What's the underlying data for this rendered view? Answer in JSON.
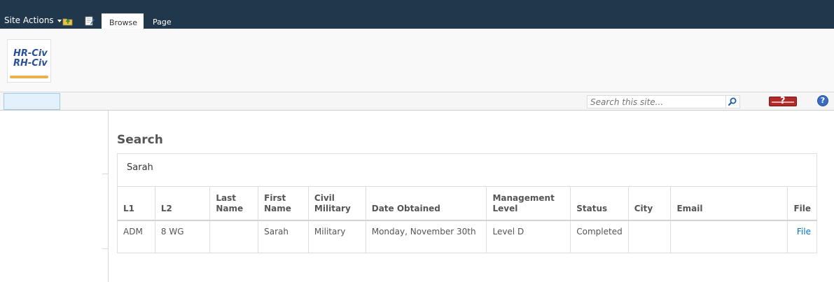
{
  "ribbon": {
    "site_actions": "Site Actions",
    "tabs": [
      {
        "label": "Browse",
        "selected": true
      },
      {
        "label": "Page",
        "selected": false
      }
    ],
    "icons": [
      "navigate-up-icon",
      "edit-page-icon"
    ]
  },
  "site": {
    "logo_line1": "HR-Civ",
    "logo_line2": "RH-Civ"
  },
  "topnav": {
    "search_placeholder": "Search this site...",
    "search_icon": "search-icon",
    "alert_icon": "alert-icon",
    "help_icon": "help-icon",
    "help_glyph": "?"
  },
  "main": {
    "title": "Search",
    "search_value": "Sarah",
    "table": {
      "columns": [
        "L1",
        "L2",
        "Last Name",
        "First Name",
        "Civil Military",
        "Date Obtained",
        "Management Level",
        "Status",
        "City",
        "Email",
        "File"
      ],
      "rows": [
        [
          "ADM",
          "8 WG",
          "",
          "Sarah",
          "Military",
          "Monday, November 30th",
          "Level D",
          "Completed",
          "",
          "",
          "File"
        ]
      ]
    }
  },
  "colors": {
    "ribbon_bg": "#21374c",
    "link": "#0072c6",
    "nav_selected": "#e3f1fc"
  }
}
